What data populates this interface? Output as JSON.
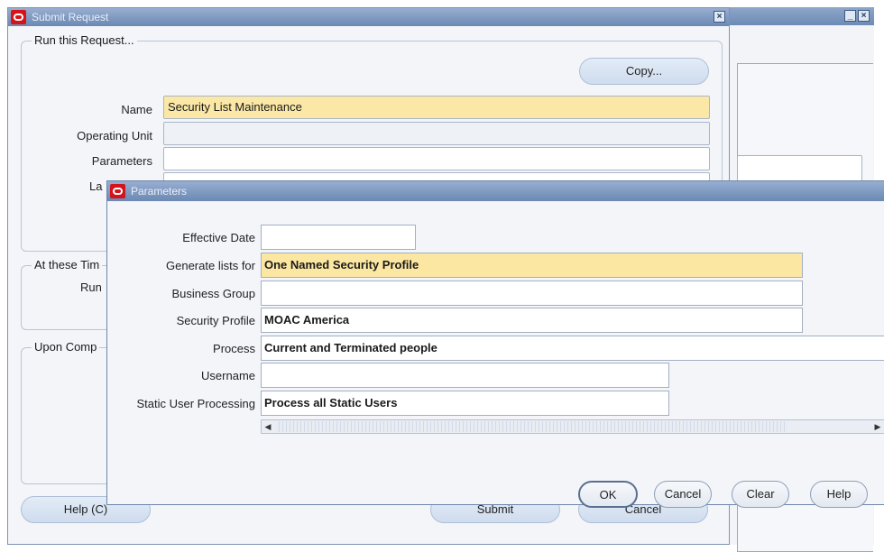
{
  "bg_window": {},
  "submit_window": {
    "title": "Submit Request",
    "run_group_label": "Run this Request...",
    "copy_button": "Copy...",
    "name_label": "Name",
    "name_value": "Security List Maintenance",
    "operating_unit_label": "Operating Unit",
    "operating_unit_value": "",
    "parameters_label": "Parameters",
    "parameters_value": "",
    "language_label_partial": "La",
    "at_these_times_label": "At these Tim",
    "run_label_partial": "Run",
    "upon_completion_label": "Upon Comp",
    "help_button": "Help (C)",
    "submit_button": "Submit",
    "cancel_button": "Cancel"
  },
  "parameters_dialog": {
    "title": "Parameters",
    "fields": [
      {
        "label": "Effective Date",
        "value": ""
      },
      {
        "label": "Generate lists for",
        "value": "One Named Security Profile"
      },
      {
        "label": "Business Group",
        "value": ""
      },
      {
        "label": "Security Profile",
        "value": "MOAC America"
      },
      {
        "label": "Process",
        "value": "Current and Terminated people"
      },
      {
        "label": "Username",
        "value": ""
      },
      {
        "label": "Static User Processing",
        "value": "Process all Static Users"
      }
    ],
    "buttons": {
      "ok": "OK",
      "cancel": "Cancel",
      "clear": "Clear",
      "help": "Help"
    }
  },
  "colors": {
    "title_bar": "#7f9ac2",
    "required_field": "#fce7a2",
    "oracle_red": "#d4141a"
  }
}
